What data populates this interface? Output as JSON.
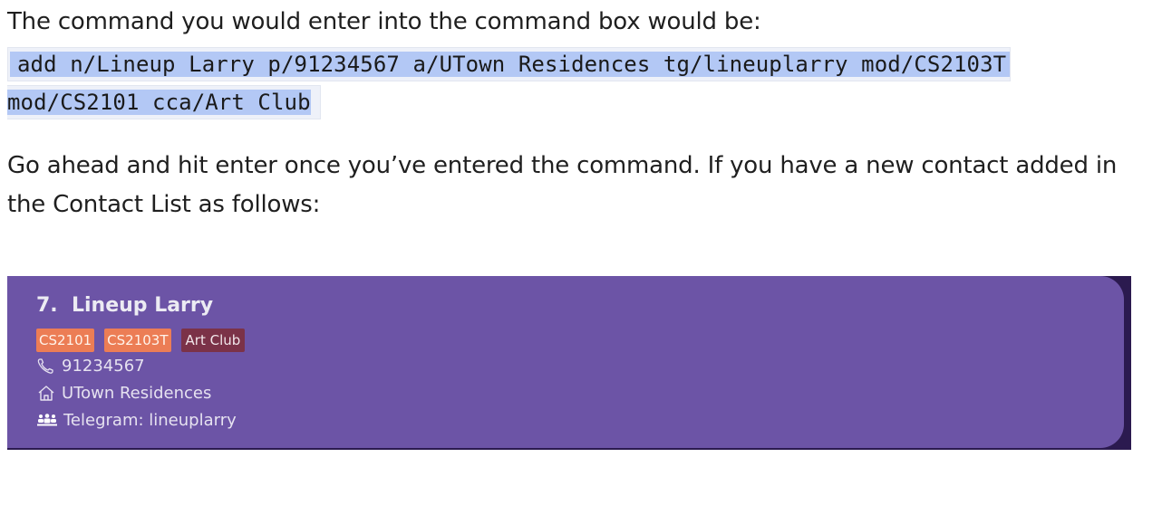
{
  "doc": {
    "intro": "The command you would enter into the command box would be:",
    "command_line1": "add n/Lineup Larry p/91234567 a/UTown Residences tg/lineuplarry mod/CS2103T",
    "command_line2": "mod/CS2101 cca/Art Club",
    "follow_up_line1": "Go ahead and hit enter once you’ve entered the command. If you have a new contact added in",
    "follow_up_line2": "the Contact List as follows:"
  },
  "contact_card": {
    "title": "7.  Lineup Larry",
    "tags": [
      {
        "label": "CS2101",
        "kind": "module"
      },
      {
        "label": "CS2103T",
        "kind": "module"
      },
      {
        "label": "Art Club",
        "kind": "cca"
      }
    ],
    "phone": "91234567",
    "address": "UTown Residences",
    "telegram": "Telegram: lineuplarry",
    "icons": [
      "phone-icon",
      "home-icon",
      "group-icon"
    ]
  },
  "colors": {
    "card_bg": "#6c54a6",
    "frame_bg": "#2b1a4f",
    "module_tag": "#ec7d55",
    "cca_tag": "#7b3248",
    "selection_highlight": "#b3c8f5"
  }
}
